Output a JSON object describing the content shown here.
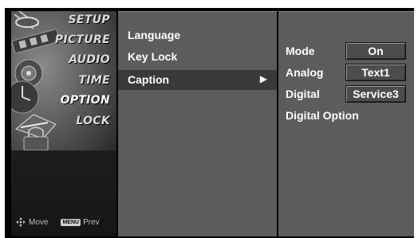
{
  "categories": [
    {
      "label": "SETUP",
      "icon": "satellite-dish-icon"
    },
    {
      "label": "PICTURE",
      "icon": "picture-icon"
    },
    {
      "label": "AUDIO",
      "icon": "speaker-icon"
    },
    {
      "label": "TIME",
      "icon": "clock-icon"
    },
    {
      "label": "OPTION",
      "icon": "option-icon"
    },
    {
      "label": "LOCK",
      "icon": "lock-icon"
    }
  ],
  "active_category": "OPTION",
  "nav_hint": {
    "move_label": "Move",
    "menu_key_label": "MENU",
    "prev_label": "Prev"
  },
  "menu": {
    "items": [
      {
        "label": "Language",
        "selected": false
      },
      {
        "label": "Key Lock",
        "selected": false
      },
      {
        "label": "Caption",
        "selected": true,
        "arrow": "▶"
      }
    ]
  },
  "caption_settings": {
    "rows": [
      {
        "label": "Mode",
        "value": "On"
      },
      {
        "label": "Analog",
        "value": "Text1"
      },
      {
        "label": "Digital",
        "value": "Service3"
      },
      {
        "label": "Digital Option",
        "value": null
      }
    ]
  },
  "colors": {
    "panel": "#5c5c5c",
    "selected_row": "#3a3a3a",
    "frame": "#000000",
    "text": "#ffffff"
  }
}
